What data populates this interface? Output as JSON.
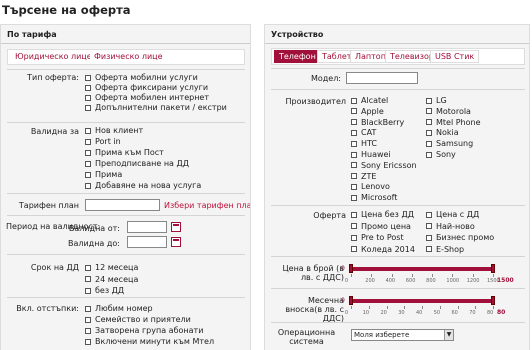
{
  "page": {
    "title": "Търсене на оферта"
  },
  "left": {
    "header": "По тарифа",
    "tabs": [
      "Юридическо лице",
      "Физическо лице"
    ],
    "offer_type": {
      "label": "Тип оферта:",
      "options": [
        "Оферта мобилни услуги",
        "Оферта фиксирани услуги",
        "Оферта мобилен интернет",
        "Допълнителни пакети / екстри"
      ]
    },
    "valid_for": {
      "label": "Валидна за",
      "options": [
        "Нов клиент",
        "Port in",
        "Прима към Пост",
        "Преподписване на ДД",
        "Прима",
        "Добавяне на нова услуга"
      ]
    },
    "tariff": {
      "label": "Тарифен план",
      "value": "",
      "link": "Избери тарифен план"
    },
    "validity": {
      "label": "Период на валидност:",
      "from": "Валидна от:",
      "to": "Валидна до:"
    },
    "term": {
      "label": "Срок на ДД",
      "options": [
        "12 месеца",
        "24 месеца",
        "без ДД"
      ]
    },
    "discounts": {
      "label": "Вкл. отстъпки:",
      "options": [
        "Любим номер",
        "Семейство и приятели",
        "Затворена група абонати",
        "Включени минути към Мтел"
      ]
    }
  },
  "right": {
    "header": "Устройство",
    "tabs": [
      "Телефон",
      "Таблет",
      "Лаптоп",
      "Телевизор",
      "USB Стик"
    ],
    "model": {
      "label": "Модел:",
      "value": ""
    },
    "maker": {
      "label": "Производител",
      "col1": [
        "Alcatel",
        "Apple",
        "BlackBerry",
        "CAT",
        "HTC",
        "Huawei",
        "Sony Ericsson",
        "ZTE",
        "Lenovo",
        "Microsoft"
      ],
      "col2": [
        "LG",
        "Motorola",
        "Mtel Phone",
        "Nokia",
        "Samsung",
        "Sony"
      ]
    },
    "offer": {
      "label": "Оферта",
      "col1": [
        "Цена без ДД",
        "Промо цена",
        "Pre to Post",
        "Коледа 2014"
      ],
      "col2": [
        "Цена с ДД",
        "Най-ново",
        "Бизнес промо",
        "E-Shop"
      ]
    },
    "price": {
      "label": "Цена в брой (в лв. с ДДС)",
      "min": "0",
      "max": "1500",
      "ticks": [
        "0",
        "200",
        "400",
        "600",
        "800",
        "1000",
        "1200",
        "1500"
      ]
    },
    "monthly": {
      "label": "Месечна вноска(в лв. с ДДС)",
      "min": "0",
      "max": "80",
      "ticks": [
        "0",
        "10",
        "20",
        "30",
        "40",
        "50",
        "60",
        "70",
        "80"
      ]
    },
    "os": {
      "label": "Операционна система",
      "value": "Моля изберете"
    }
  },
  "colors": {
    "accent": "#a0103a",
    "panel": "#f4f4f4"
  }
}
